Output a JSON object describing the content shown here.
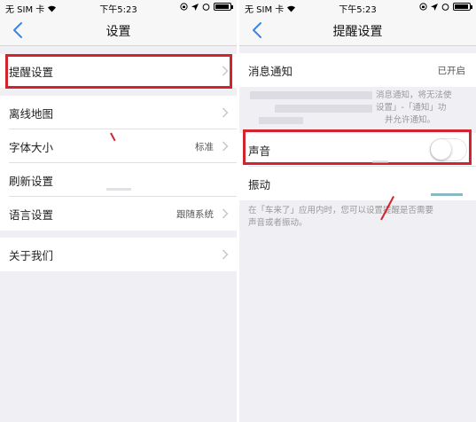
{
  "status_bar": {
    "carrier": "无 SIM 卡",
    "time": "下午5:23"
  },
  "left": {
    "nav_title": "设置",
    "rows": [
      {
        "label": "提醒设置",
        "value": ""
      },
      {
        "label": "离线地图",
        "value": ""
      },
      {
        "label": "字体大小",
        "value": "标准"
      },
      {
        "label": "刷新设置",
        "value": ""
      },
      {
        "label": "语言设置",
        "value": "跟随系统"
      },
      {
        "label": "关于我们",
        "value": ""
      }
    ]
  },
  "right": {
    "nav_title": "提醒设置",
    "notify_label": "消息通知",
    "notify_value": "已开启",
    "notify_note_line1": "消息通知，将无法使",
    "notify_note_line2": "设置」-「通知」功",
    "notify_note_line3": "并允许通知。",
    "sound_label": "声音",
    "sound_on": false,
    "vibrate_label": "振动",
    "vibrate_note_line1": "在「车来了」应用内时，您可以设置提醒是否需要",
    "vibrate_note_line2": "声音或者振动。"
  },
  "colors": {
    "highlight": "#d3232e",
    "accent_blue": "#3a86e8",
    "background": "#efeff4"
  }
}
